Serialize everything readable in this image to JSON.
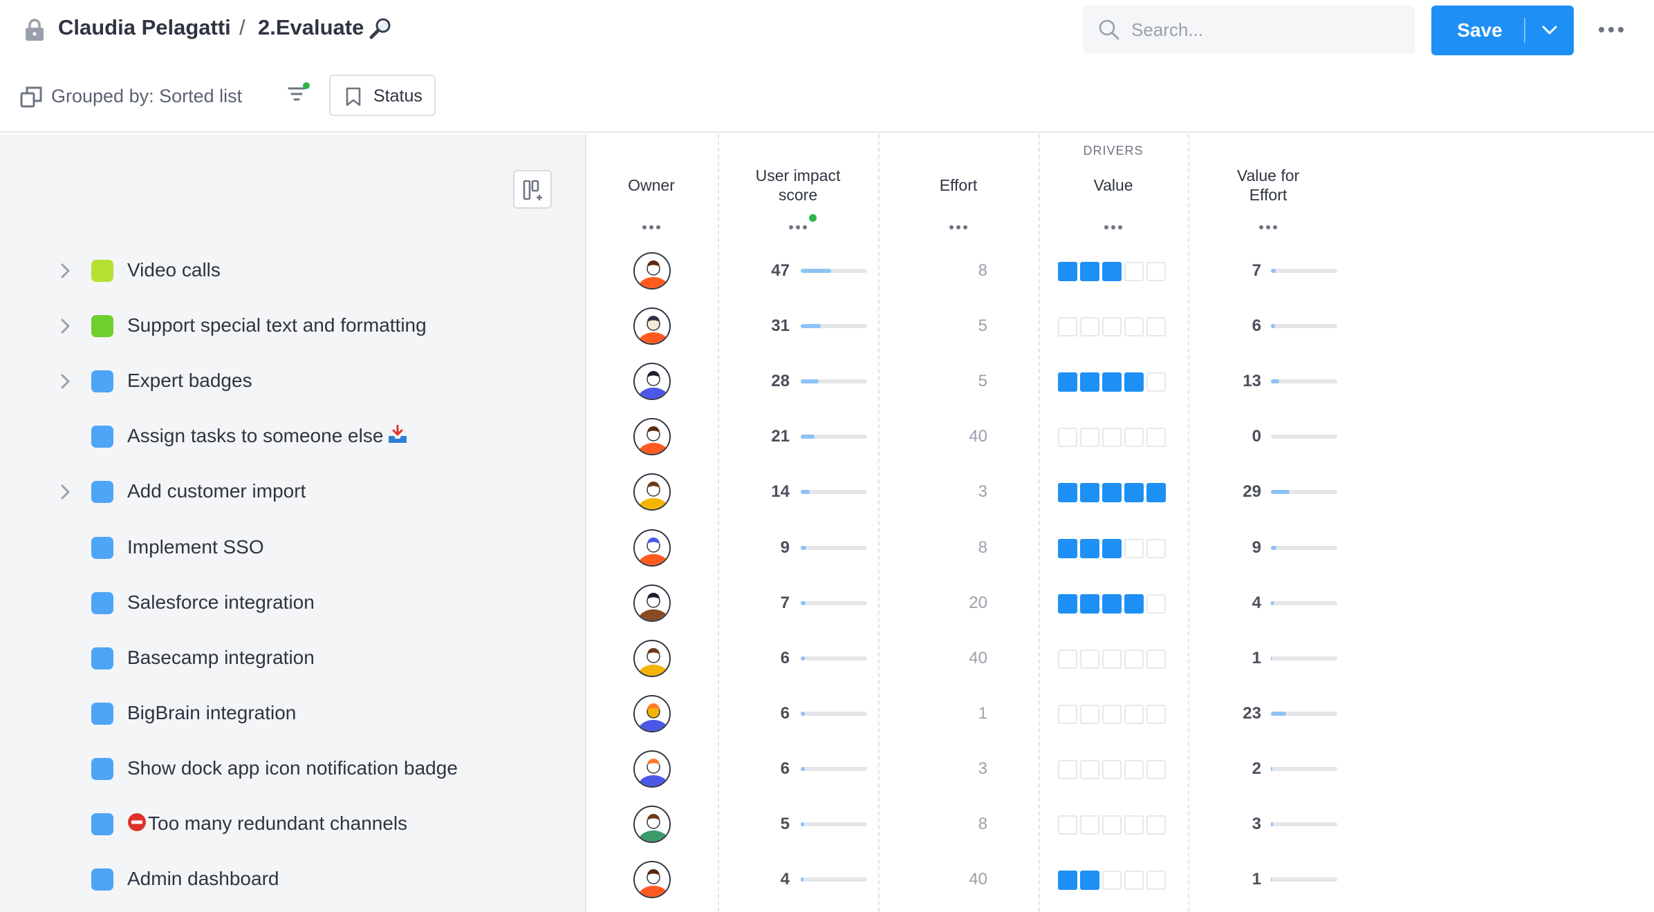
{
  "breadcrumb": {
    "owner": "Claudia Pelagatti",
    "separator": "/",
    "page": "2.Evaluate"
  },
  "search": {
    "placeholder": "Search..."
  },
  "toolbar": {
    "save_label": "Save"
  },
  "subbar": {
    "grouped_label": "Grouped by: Sorted list",
    "status_label": "Status"
  },
  "colors": {
    "accent": "#1e90f5",
    "bar": "#8ec2f7",
    "lime": "#b5df33",
    "green": "#6fcf2f",
    "blue": "#4ea4f7",
    "filter_dot": "#2cb34a"
  },
  "columns": {
    "owner": "Owner",
    "impact": [
      "User impact",
      "score"
    ],
    "effort": "Effort",
    "drivers_group": "DRIVERS",
    "value": "Value",
    "vfe": [
      "Value for",
      "Effort"
    ]
  },
  "rows": [
    {
      "title": "Video calls",
      "expandable": true,
      "swatch": "lime",
      "impact": 47,
      "effort": 8,
      "value": 3,
      "vfe": 7,
      "avatar": "orange"
    },
    {
      "title": "Support special text and formatting",
      "expandable": true,
      "swatch": "green",
      "impact": 31,
      "effort": 5,
      "value": 0,
      "vfe": 6,
      "avatar": "orange-sketch"
    },
    {
      "title": "Expert badges",
      "expandable": true,
      "swatch": "blue",
      "impact": 28,
      "effort": 5,
      "value": 4,
      "vfe": 13,
      "avatar": "blue-dark"
    },
    {
      "title": "Assign tasks to someone else",
      "expandable": false,
      "swatch": "blue",
      "impact": 21,
      "effort": 40,
      "value": 0,
      "vfe": 0,
      "avatar": "orange",
      "emoji_after": "inbox-tray"
    },
    {
      "title": "Add customer import",
      "expandable": true,
      "swatch": "blue",
      "impact": 14,
      "effort": 3,
      "value": 5,
      "vfe": 29,
      "avatar": "yellow"
    },
    {
      "title": "Implement SSO",
      "expandable": false,
      "swatch": "blue",
      "impact": 9,
      "effort": 8,
      "value": 3,
      "vfe": 9,
      "avatar": "orange-blue"
    },
    {
      "title": "Salesforce integration",
      "expandable": false,
      "swatch": "blue",
      "impact": 7,
      "effort": 20,
      "value": 4,
      "vfe": 4,
      "avatar": "brown"
    },
    {
      "title": "Basecamp integration",
      "expandable": false,
      "swatch": "blue",
      "impact": 6,
      "effort": 40,
      "value": 0,
      "vfe": 1,
      "avatar": "yellow"
    },
    {
      "title": "BigBrain integration",
      "expandable": false,
      "swatch": "blue",
      "impact": 6,
      "effort": 1,
      "value": 0,
      "vfe": 23,
      "avatar": "yellow-blue"
    },
    {
      "title": "Show dock app icon notification badge",
      "expandable": false,
      "swatch": "blue",
      "impact": 6,
      "effort": 3,
      "value": 0,
      "vfe": 2,
      "avatar": "blue-orange"
    },
    {
      "title": "Too many redundant channels",
      "expandable": false,
      "swatch": "blue",
      "impact": 5,
      "effort": 8,
      "value": 0,
      "vfe": 3,
      "avatar": "green",
      "emoji_before": "no-entry"
    },
    {
      "title": "Admin dashboard",
      "expandable": false,
      "swatch": "blue",
      "impact": 4,
      "effort": 40,
      "value": 2,
      "vfe": 1,
      "avatar": "orange"
    }
  ],
  "scales": {
    "impact_max": 100,
    "value_max": 5,
    "vfe_max": 100
  }
}
